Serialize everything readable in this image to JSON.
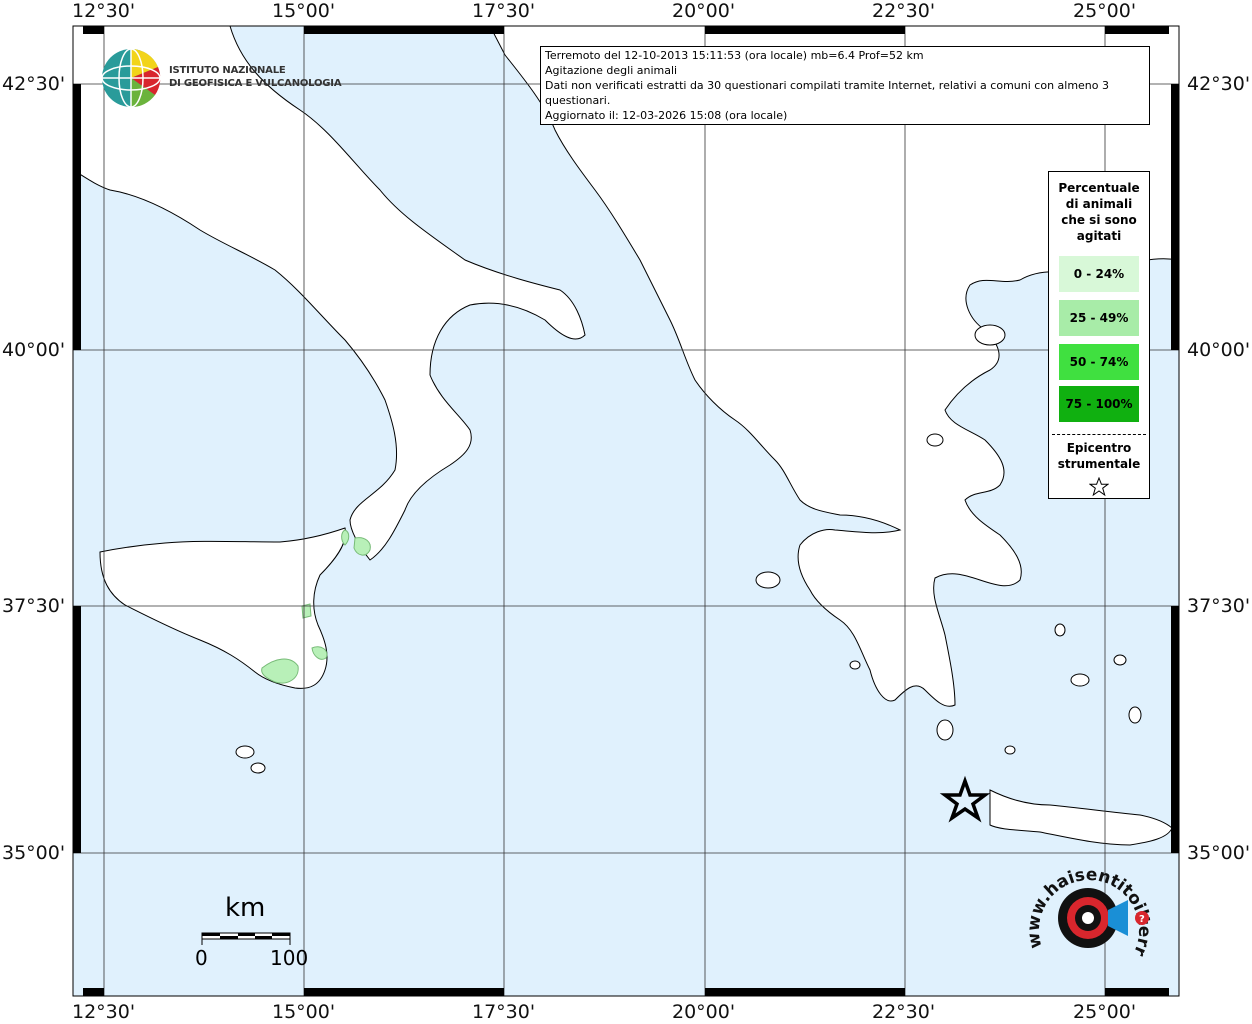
{
  "info": {
    "line1": "Terremoto del 12-10-2013 15:11:53 (ora locale) mb=6.4 Prof=52 km",
    "line2": "Agitazione degli animali",
    "line3": "Dati non verificati estratti da 30 questionari compilati tramite Internet, relativi a comuni con almeno 3 questionari.",
    "line4": "Aggiornato il: 12-03-2026 15:08 (ora locale)"
  },
  "ingv": {
    "line1": "ISTITUTO NAZIONALE",
    "line2": "DI GEOFISICA E VULCANOLOGIA"
  },
  "axes": {
    "lon_labels": [
      "12°30'",
      "15°00'",
      "17°30'",
      "20°00'",
      "22°30'",
      "25°00'"
    ],
    "lat_labels": [
      "42°30'",
      "40°00'",
      "37°30'",
      "35°00'"
    ]
  },
  "legend": {
    "title": [
      "Percentuale",
      "di animali",
      "che si sono",
      "agitati"
    ],
    "classes": [
      {
        "label": "0 - 24%",
        "color": "#d8f8d8"
      },
      {
        "label": "25 - 49%",
        "color": "#a8eca8"
      },
      {
        "label": "50 - 74%",
        "color": "#40e040"
      },
      {
        "label": "75 - 100%",
        "color": "#10b010"
      }
    ],
    "epicenter_label": [
      "Epicentro",
      "strumentale"
    ]
  },
  "scale": {
    "unit": "km",
    "min": "0",
    "max": "100"
  },
  "hsit": {
    "text": "www.haisentitoilterremoto.it"
  },
  "colors": {
    "sea": "#e0f1fd",
    "land": "#ffffff",
    "frame": "#000000",
    "responded": "#b8f0b8"
  },
  "epicenter": {
    "lon": 23.25,
    "lat": 35.5
  }
}
